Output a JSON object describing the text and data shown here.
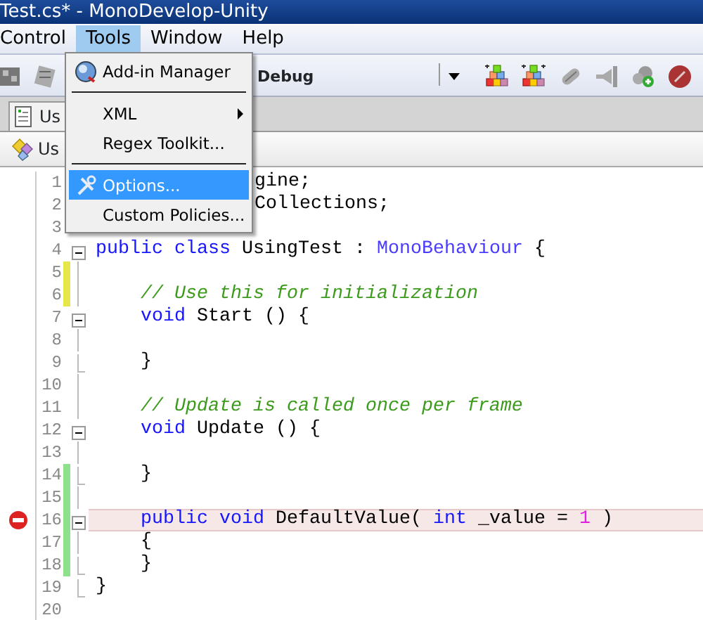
{
  "window": {
    "title": "Test.cs* - MonoDevelop-Unity"
  },
  "menu_bar": [
    {
      "label": "Control",
      "selected": false
    },
    {
      "label": "Tools",
      "selected": true
    },
    {
      "label": "Window",
      "selected": false
    },
    {
      "label": "Help",
      "selected": false
    }
  ],
  "toolbar": {
    "configuration": "Debug"
  },
  "document_tab": {
    "label": "Us"
  },
  "breadcrumb": {
    "label": "Us"
  },
  "tools_menu": [
    {
      "kind": "item",
      "label": "Add-in Manager",
      "selected": false
    },
    {
      "kind": "separator"
    },
    {
      "kind": "item",
      "label": "XML",
      "selected": false,
      "submenu": true
    },
    {
      "kind": "item",
      "label": "Regex Toolkit...",
      "selected": false
    },
    {
      "kind": "separator"
    },
    {
      "kind": "item",
      "label": "Options...",
      "selected": true
    },
    {
      "kind": "item",
      "label": "Custom Policies...",
      "selected": false
    }
  ],
  "editor": {
    "lines": [
      {
        "number": "1",
        "covered": true,
        "tokens": [
          {
            "kind": "plain",
            "text": "gine;"
          }
        ]
      },
      {
        "number": "2",
        "covered": true,
        "tokens": [
          {
            "kind": "plain",
            "text": "Collections;"
          }
        ]
      },
      {
        "number": "3"
      },
      {
        "number": "4",
        "fold_toggle": true,
        "tokens": [
          {
            "kind": "keyword",
            "text": "public class"
          },
          {
            "kind": "plain",
            "text": " UsingTest : "
          },
          {
            "kind": "type",
            "text": "MonoBehaviour"
          },
          {
            "kind": "plain",
            "text": " {"
          }
        ]
      },
      {
        "number": "5",
        "changed": true,
        "saved": true,
        "fold_guide": true
      },
      {
        "number": "6",
        "changed": true,
        "saved": true,
        "fold_guide": true,
        "tokens": [
          {
            "kind": "comment",
            "text": "    // Use this for initialization"
          }
        ]
      },
      {
        "number": "7",
        "fold_toggle": true,
        "tokens": [
          {
            "kind": "keyword",
            "text": "    void"
          },
          {
            "kind": "plain",
            "text": " Start () {"
          }
        ]
      },
      {
        "number": "8",
        "fold_guide": true
      },
      {
        "number": "9",
        "fold_end": true,
        "tokens": [
          {
            "kind": "plain",
            "text": "    }"
          }
        ]
      },
      {
        "number": "10",
        "fold_guide": true
      },
      {
        "number": "11",
        "fold_guide": true,
        "tokens": [
          {
            "kind": "comment",
            "text": "    // Update is called once per frame"
          }
        ]
      },
      {
        "number": "12",
        "fold_toggle": true,
        "tokens": [
          {
            "kind": "keyword",
            "text": "    void"
          },
          {
            "kind": "plain",
            "text": " Update () {"
          }
        ]
      },
      {
        "number": "13",
        "fold_guide": true
      },
      {
        "number": "14",
        "changed": true,
        "saved": false,
        "fold_end": true,
        "tokens": [
          {
            "kind": "plain",
            "text": "    }"
          }
        ]
      },
      {
        "number": "15",
        "changed": true,
        "saved": false,
        "fold_guide": true
      },
      {
        "number": "16",
        "changed": true,
        "saved": false,
        "fold_toggle": true,
        "error": true,
        "current": true,
        "tokens": [
          {
            "kind": "keyword",
            "text": "    public void"
          },
          {
            "kind": "plain",
            "text": " DefaultValue( "
          },
          {
            "kind": "keyword",
            "text": "int"
          },
          {
            "kind": "plain",
            "text": " _value = "
          },
          {
            "kind": "number",
            "text": "1"
          },
          {
            "kind": "plain",
            "text": " )"
          }
        ]
      },
      {
        "number": "17",
        "changed": true,
        "saved": false,
        "fold_guide": true,
        "tokens": [
          {
            "kind": "plain",
            "text": "    {"
          }
        ]
      },
      {
        "number": "18",
        "changed": true,
        "saved": false,
        "fold_end": true,
        "tokens": [
          {
            "kind": "plain",
            "text": "    }"
          }
        ]
      },
      {
        "number": "19",
        "fold_end": true,
        "tokens": [
          {
            "kind": "plain",
            "text": "}"
          }
        ]
      },
      {
        "number": "20"
      }
    ]
  }
}
